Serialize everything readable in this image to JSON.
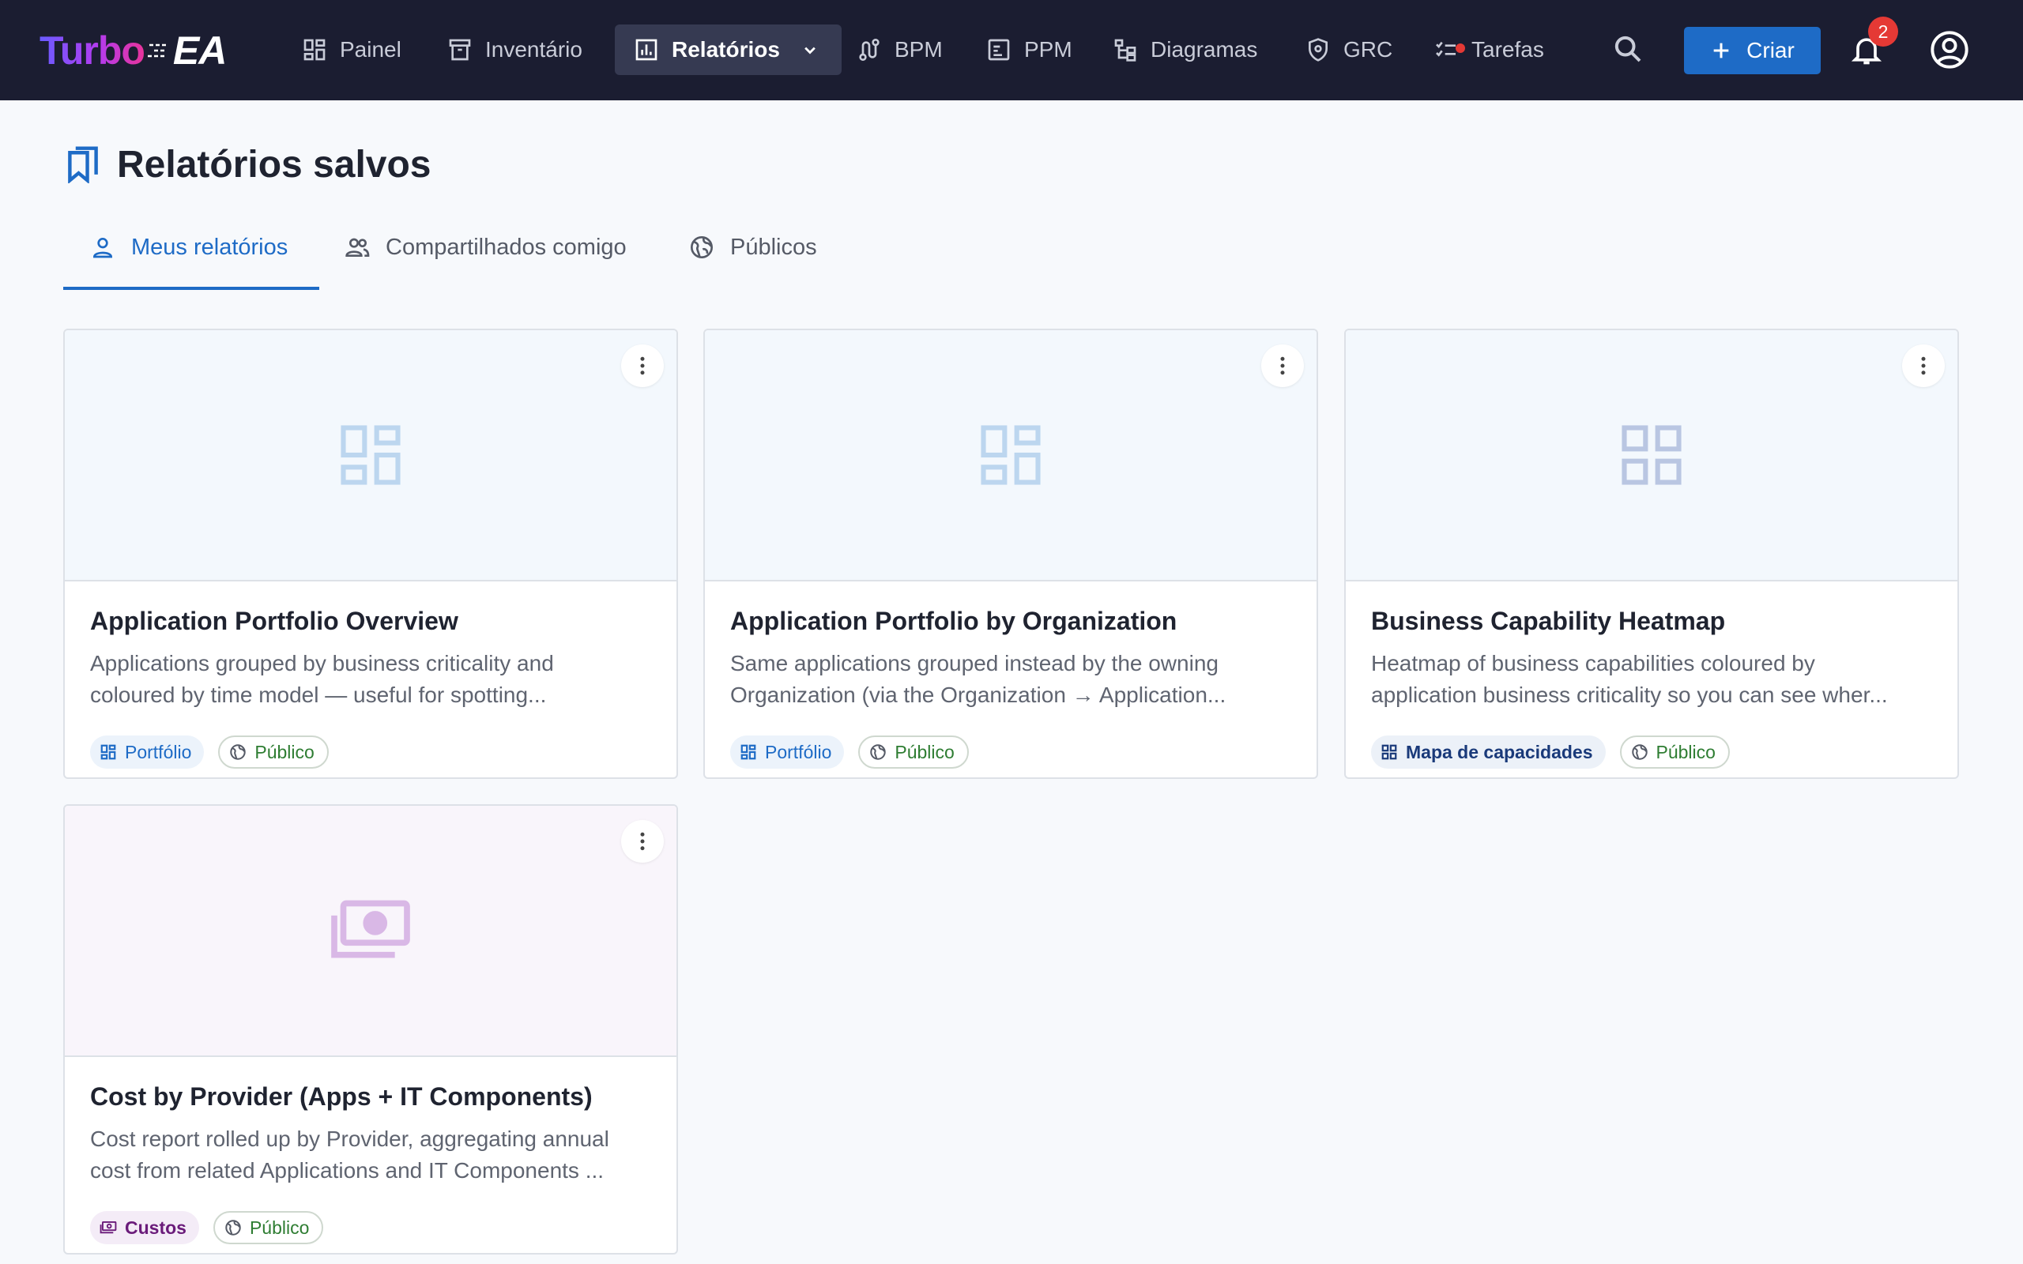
{
  "app": {
    "logo_turbo": "Turbo",
    "logo_ea": "EA"
  },
  "nav": {
    "items": [
      {
        "label": "Painel",
        "icon": "dashboard-icon"
      },
      {
        "label": "Inventário",
        "icon": "archive-icon"
      },
      {
        "label": "Relatórios",
        "icon": "bar-chart-icon",
        "active": true
      },
      {
        "label": "BPM",
        "icon": "route-icon"
      },
      {
        "label": "PPM",
        "icon": "project-icon"
      },
      {
        "label": "Diagramas",
        "icon": "tree-icon"
      },
      {
        "label": "GRC",
        "icon": "shield-icon"
      },
      {
        "label": "Tarefas",
        "icon": "checklist-icon"
      }
    ],
    "create_label": "Criar",
    "notification_count": "2"
  },
  "page": {
    "title": "Relatórios salvos",
    "tabs": [
      {
        "label": "Meus relatórios",
        "icon": "person-icon",
        "active": true
      },
      {
        "label": "Compartilhados comigo",
        "icon": "people-icon"
      },
      {
        "label": "Públicos",
        "icon": "globe-icon"
      }
    ]
  },
  "reports": [
    {
      "title": "Application Portfolio Overview",
      "description_line1": "Applications grouped by business criticality and",
      "description_line2": "coloured by time model — useful for spotting...",
      "type_label": "Portfólio",
      "visibility_label": "Público",
      "icon": "dashboard-icon"
    },
    {
      "title": "Application Portfolio by Organization",
      "description_line1": "Same applications grouped instead by the owning",
      "description_line2": "Organization (via the Organization → Application...",
      "type_label": "Portfólio",
      "visibility_label": "Público",
      "icon": "dashboard-icon"
    },
    {
      "title": "Business Capability Heatmap",
      "description_line1": "Heatmap of business capabilities coloured by",
      "description_line2": "application business criticality so you can see wher...",
      "type_label": "Mapa de capacidades",
      "visibility_label": "Público",
      "icon": "dashboard-icon"
    },
    {
      "title": "Cost by Provider (Apps + IT Components)",
      "description_line1": "Cost report rolled up by Provider, aggregating annual",
      "description_line2": "cost from related Applications and IT Components ...",
      "type_label": "Custos",
      "visibility_label": "Público",
      "icon": "money-icon"
    }
  ],
  "colors": {
    "topbar": "#1b1d31",
    "accent": "#1e6bc6",
    "badge": "#e53935",
    "public_green": "#2e7d32"
  }
}
